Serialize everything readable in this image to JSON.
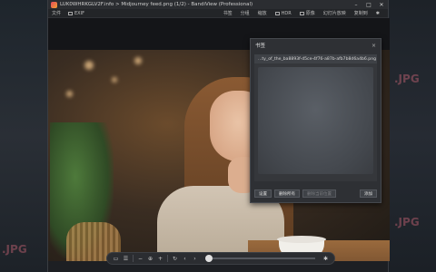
{
  "window": {
    "title": "LUK0WHRKGLV2F.info > Midjourney feed.png (1/2) - BandiView (Professional)",
    "controls": [
      "–",
      "□",
      "✕"
    ]
  },
  "menu": {
    "left": [
      "文件",
      "EXIF"
    ],
    "right": [
      "书签",
      "分组",
      "缩放",
      "HDR",
      "原像",
      "幻灯片放映",
      "复制到"
    ]
  },
  "bookmark_panel": {
    "title": "书签",
    "close": "×",
    "items": [
      {
        "label": "...ty_of_the_ba8893f-d5ce-4f76-a87b-afb7b8d6a4b6.png"
      }
    ],
    "buttons": {
      "add": "添加",
      "delete_all": "删除所有",
      "delete_current": "删除当前位置",
      "settings": "设置"
    }
  },
  "toolbar": {
    "icons": [
      "folder-icon",
      "grid-icon",
      "zoom-out-icon",
      "zoom-in-icon",
      "fit-icon",
      "rotate-icon",
      "prev-icon",
      "next-icon",
      "pin-icon"
    ],
    "slider_position": 0.0
  },
  "desktop": {
    "labels": [
      ".JPG",
      ".JPG",
      ".JPG"
    ]
  }
}
